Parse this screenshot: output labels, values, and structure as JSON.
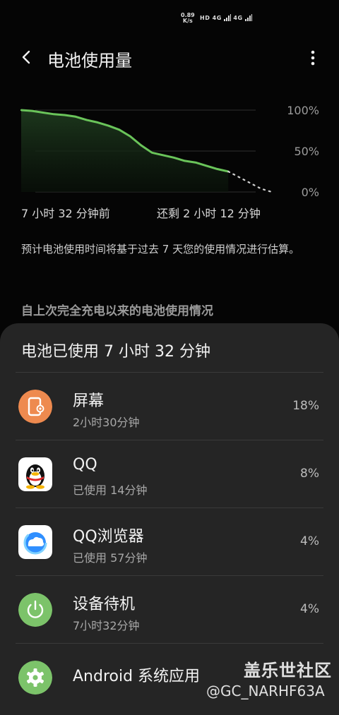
{
  "status_bar": {
    "speed_value": "0.89",
    "speed_unit": "K/s",
    "hd": "HD",
    "net1": "4G",
    "net2": "4G"
  },
  "header": {
    "title": "电池使用量"
  },
  "chart_data": {
    "type": "line",
    "y_ticks": [
      "100%",
      "50%",
      "0%"
    ],
    "ylim": [
      0,
      100
    ],
    "x_labels": [
      "7 小时 32 分钟前",
      "还剩 2 小时 12 分钟"
    ],
    "series": [
      {
        "values": [
          100,
          99,
          97,
          95,
          94,
          92,
          88,
          85,
          81,
          76,
          68,
          57,
          48,
          45,
          42,
          38,
          36,
          32,
          28,
          25
        ]
      }
    ],
    "projection": [
      25,
      18,
      11,
      4,
      0
    ],
    "grid": true,
    "line_color": "#6ac45a"
  },
  "chart_labels": {
    "start": "7 小时 32 分钟前",
    "end": "还剩 2 小时 12 分钟"
  },
  "note": "预计电池使用时间将基于过去 7 天您的使用情况进行估算。",
  "section_title": "自上次完全充电以来的电池使用情况",
  "sheet": {
    "title": "电池已使用 7 小时 32 分钟",
    "items": [
      {
        "name": "屏幕",
        "sub": "2小时30分钟",
        "pct": "18%",
        "icon": "screen-icon",
        "color": "#ee8a4f"
      },
      {
        "name": "QQ",
        "sub": "已使用 14分钟",
        "pct": "8%",
        "icon": "qq-penguin-icon",
        "color": "#ffffff"
      },
      {
        "name": "QQ浏览器",
        "sub": "已使用 57分钟",
        "pct": "4%",
        "icon": "qq-browser-icon",
        "color": "#ffffff"
      },
      {
        "name": "设备待机",
        "sub": "7小时32分钟",
        "pct": "4%",
        "icon": "power-icon",
        "color": "#7cc36a"
      },
      {
        "name": "Android 系统应用",
        "sub": "",
        "pct": "",
        "icon": "gear-icon",
        "color": "#7cc36a"
      }
    ]
  },
  "watermark": {
    "line1": "盖乐世社区",
    "line2": "@GC_NARHF63A"
  }
}
